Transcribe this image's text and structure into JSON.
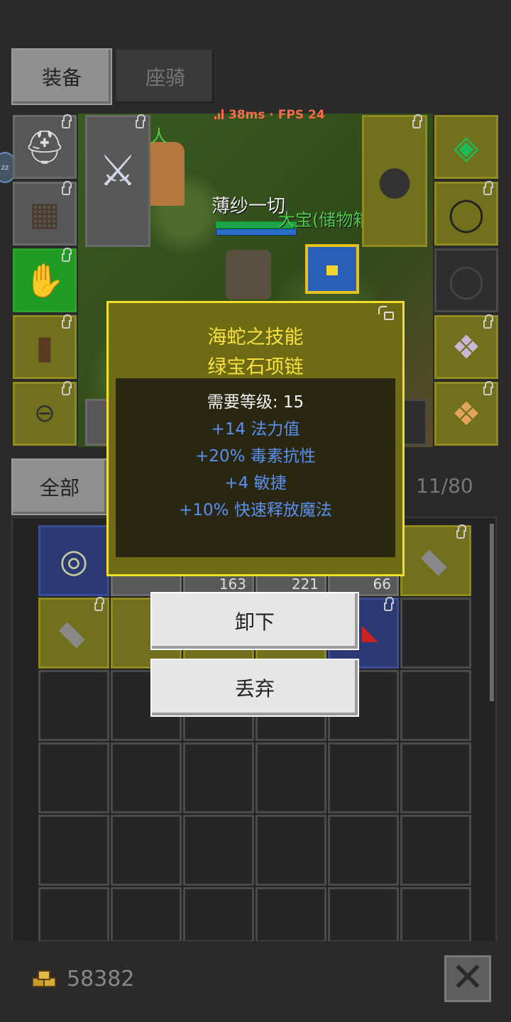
{
  "tabs": {
    "equip": "装备",
    "mount": "座骑"
  },
  "hud": {
    "net": "38ms · FPS 24"
  },
  "scene": {
    "npc_name": "人",
    "player_name": "薄纱一切",
    "chest_name": "大宝(储物箱)"
  },
  "side_dot": "zz",
  "equipment": {
    "left": [
      "helmet-icon",
      "armor-icon",
      "gloves-icon",
      "boots-icon",
      "belt-icon"
    ],
    "weapon": "sword-icon",
    "right": [
      "amulet-icon",
      "ring-icon",
      "empty-ring-icon",
      "pet-icon",
      "pet2-icon"
    ],
    "shield": "shield-icon"
  },
  "category": {
    "all": "全部",
    "capacity": "11/80"
  },
  "inventory": {
    "counts": [
      "163",
      "221",
      "66"
    ]
  },
  "tooltip": {
    "title1": "海蛇之技能",
    "title2": "绿宝石项链",
    "requirement": "需要等级: 15",
    "stats": [
      "+14 法力值",
      "+20% 毒素抗性",
      "+4 敏捷",
      "+10% 快速释放魔法"
    ]
  },
  "actions": {
    "unequip": "卸下",
    "discard": "丢弃"
  },
  "footer": {
    "gold": "58382"
  },
  "colors": {
    "tooltip_title": "#f6e23a",
    "stat": "#5b8ff0",
    "net": "#ff6b4a"
  }
}
